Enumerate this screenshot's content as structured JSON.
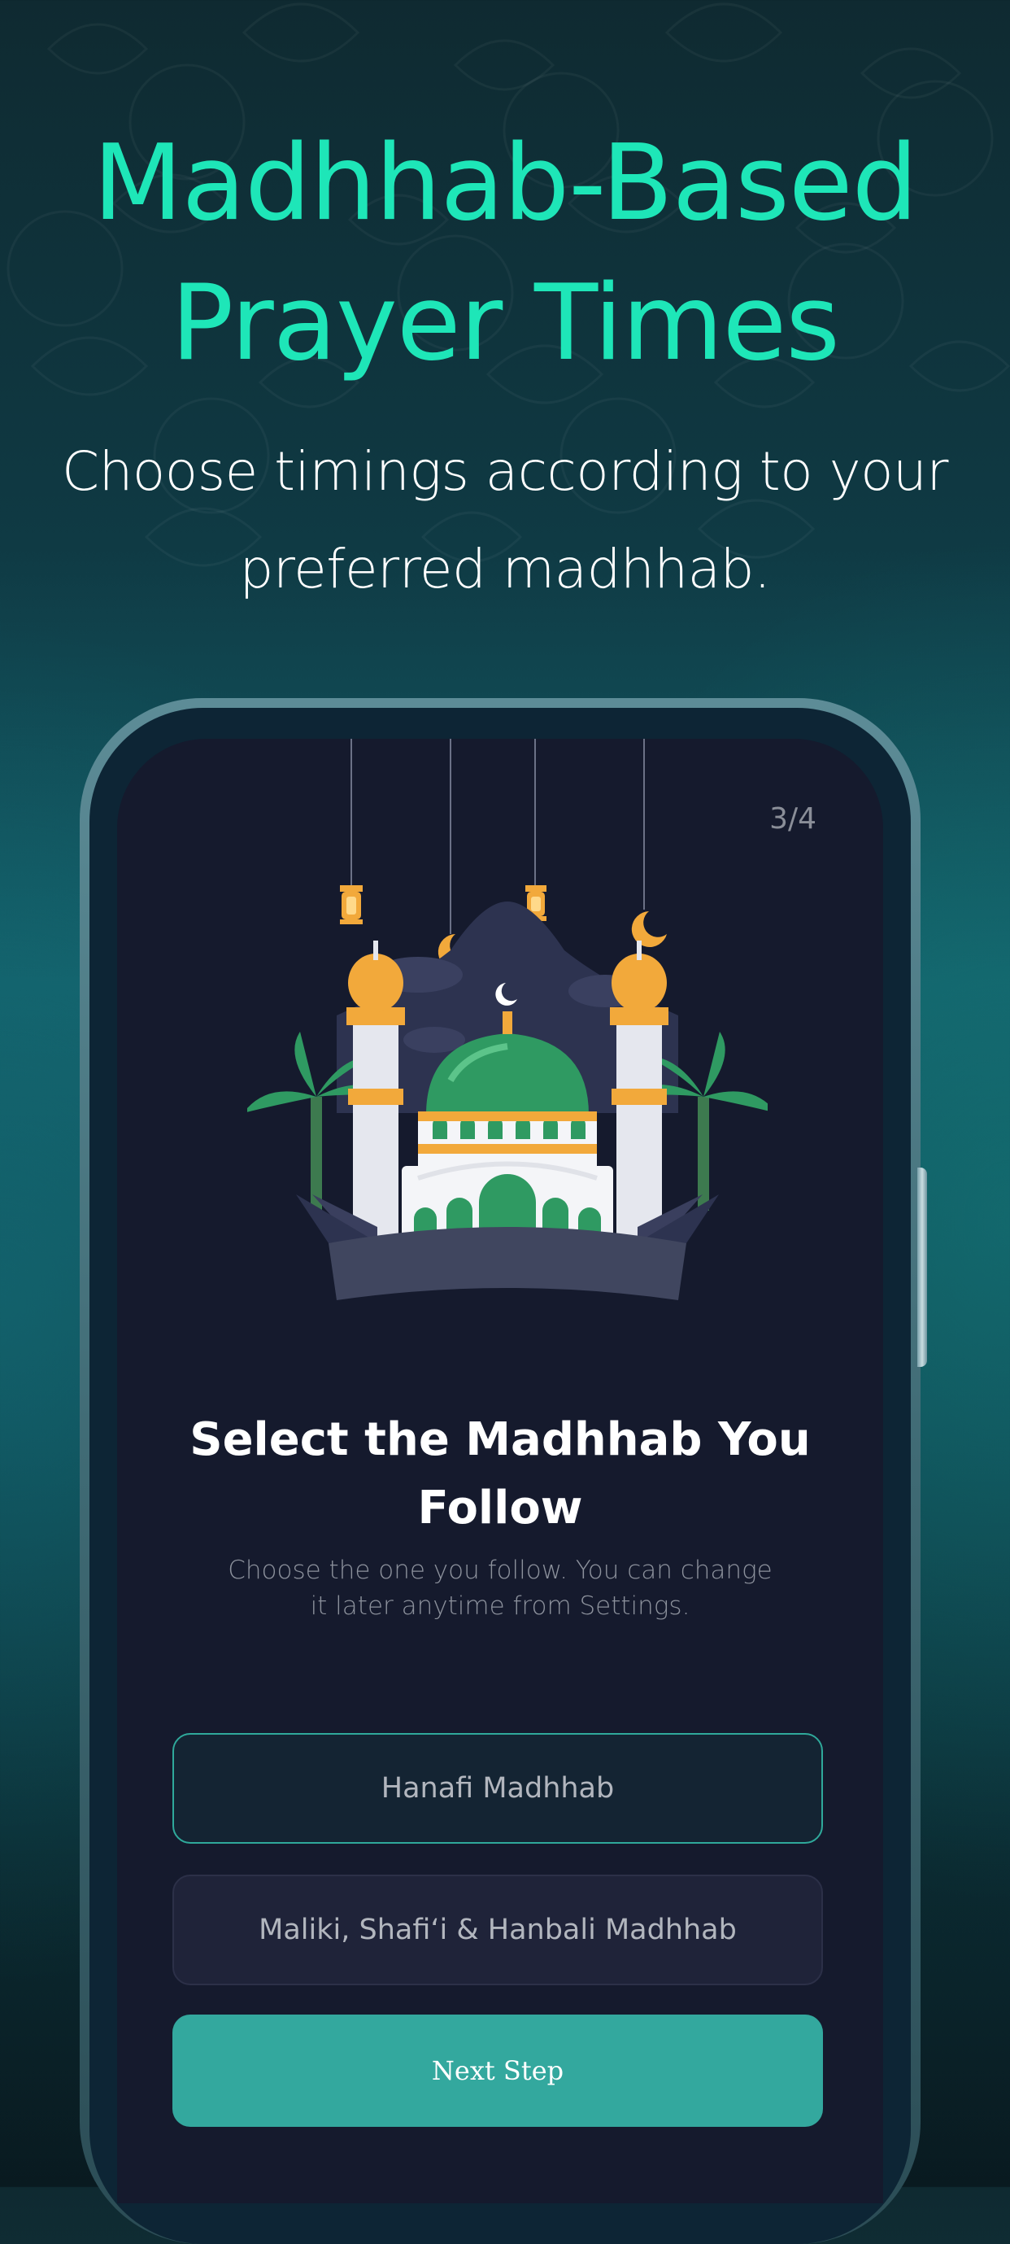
{
  "header": {
    "headline_line1": "Madhhab-Based",
    "headline_line2": "Prayer Times",
    "subline_line1": "Choose timings according to your",
    "subline_line2": "preferred madhhab."
  },
  "screen": {
    "step_counter": "3/4",
    "title_line1": "Select the Madhhab You",
    "title_line2": "Follow",
    "description_line1": "Choose the one you follow. You can change",
    "description_line2": "it later anytime from Settings.",
    "options": [
      {
        "label": "Hanafi Madhhab",
        "selected": true
      },
      {
        "label": "Maliki, Shafi‘i & Hanbali Madhhab",
        "selected": false
      }
    ],
    "next_button_label": "Next Step"
  },
  "illustration": {
    "icon": "mosque-illustration",
    "colors": {
      "accent": "#1ee6b8",
      "dome": "#2f9a62",
      "gold": "#f2a93b",
      "button": "#33a89e",
      "selected_border": "#2fa99b"
    }
  }
}
